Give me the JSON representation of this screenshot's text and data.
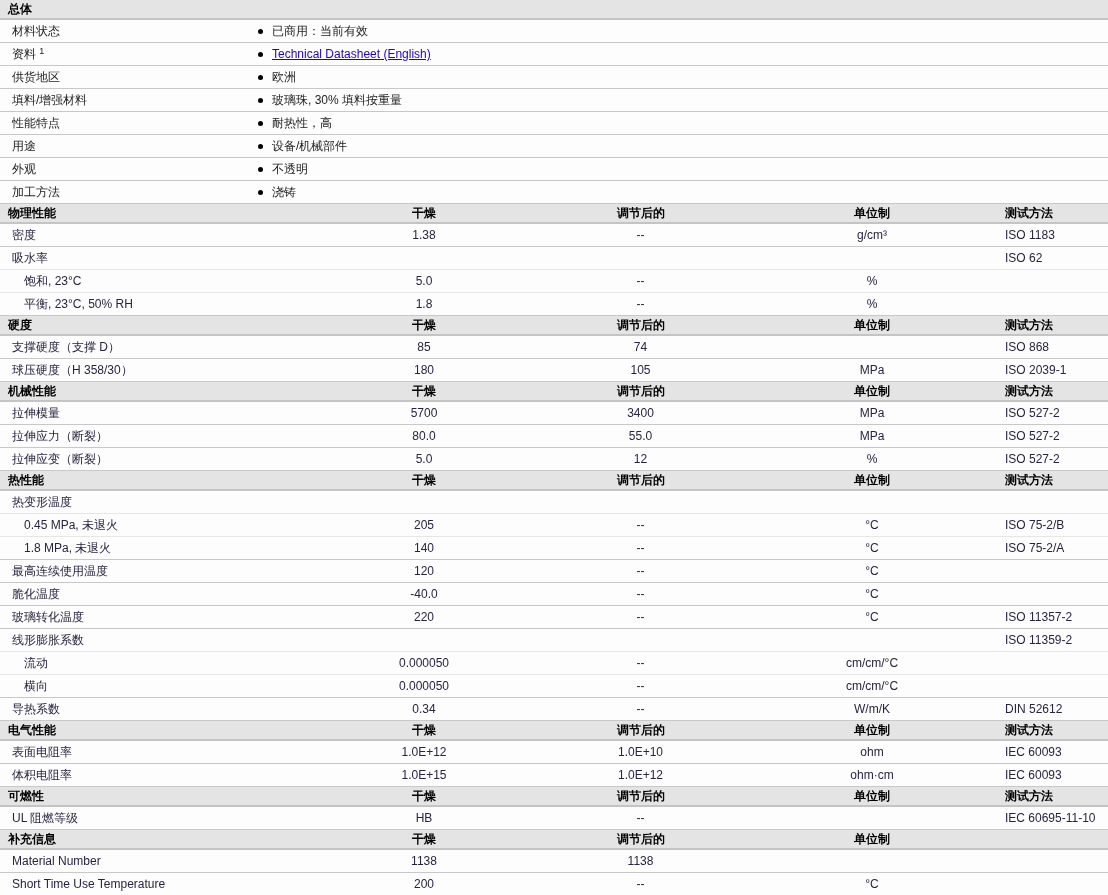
{
  "general": {
    "title": "总体",
    "rows": [
      {
        "label": "材料状态",
        "kind": "text",
        "value": "已商用：当前有效"
      },
      {
        "label": "资料 $^{1}$",
        "kind": "link",
        "value": "Technical Datasheet (English)"
      },
      {
        "label": "供货地区",
        "kind": "text",
        "value": "欧洲"
      },
      {
        "label": "填料/增强材料",
        "kind": "text",
        "value": "玻璃珠, 30% 填料按重量"
      },
      {
        "label": "性能特点",
        "kind": "text",
        "value": "耐热性，高"
      },
      {
        "label": "用途",
        "kind": "text",
        "value": "设备/机械部件"
      },
      {
        "label": "外观",
        "kind": "text",
        "value": "不透明"
      },
      {
        "label": "加工方法",
        "kind": "text",
        "value": "浇铸"
      }
    ]
  },
  "sections": [
    {
      "title": "物理性能",
      "columns": [
        "干燥",
        "调节后的",
        "单位制",
        "测试方法"
      ],
      "rows": [
        {
          "label": "密度",
          "dry": "1.38",
          "conditioned": "--",
          "unit": "g/cm³",
          "method": "ISO 1183"
        },
        {
          "label": "吸水率",
          "method": "ISO 62",
          "children": [
            {
              "label": "饱和, 23°C",
              "dry": "5.0",
              "conditioned": "--",
              "unit": "%"
            },
            {
              "label": "平衡, 23°C, 50% RH",
              "dry": "1.8",
              "conditioned": "--",
              "unit": "%"
            }
          ]
        }
      ]
    },
    {
      "title": "硬度",
      "columns": [
        "干燥",
        "调节后的",
        "单位制",
        "测试方法"
      ],
      "rows": [
        {
          "label": "支撑硬度（支撑  D）",
          "dry": "85",
          "conditioned": "74",
          "method": "ISO 868"
        },
        {
          "label": "球压硬度（H 358/30）",
          "dry": "180",
          "conditioned": "105",
          "unit": "MPa",
          "method": "ISO 2039-1"
        }
      ]
    },
    {
      "title": "机械性能",
      "columns": [
        "干燥",
        "调节后的",
        "单位制",
        "测试方法"
      ],
      "rows": [
        {
          "label": "拉伸模量",
          "dry": "5700",
          "conditioned": "3400",
          "unit": "MPa",
          "method": "ISO 527-2"
        },
        {
          "label": "拉伸应力（断裂）",
          "dry": "80.0",
          "conditioned": "55.0",
          "unit": "MPa",
          "method": "ISO 527-2"
        },
        {
          "label": "拉伸应变（断裂）",
          "dry": "5.0",
          "conditioned": "12",
          "unit": "%",
          "method": "ISO 527-2"
        }
      ]
    },
    {
      "title": "热性能",
      "columns": [
        "干燥",
        "调节后的",
        "单位制",
        "测试方法"
      ],
      "rows": [
        {
          "label": "热变形温度",
          "children": [
            {
              "label": "0.45 MPa, 未退火",
              "dry": "205",
              "conditioned": "--",
              "unit": "°C",
              "method": "ISO 75-2/B"
            },
            {
              "label": "1.8 MPa, 未退火",
              "dry": "140",
              "conditioned": "--",
              "unit": "°C",
              "method": "ISO 75-2/A"
            }
          ]
        },
        {
          "label": "最高连续使用温度",
          "dry": "120",
          "conditioned": "--",
          "unit": "°C"
        },
        {
          "label": "脆化温度",
          "dry": "-40.0",
          "conditioned": "--",
          "unit": "°C"
        },
        {
          "label": "玻璃转化温度",
          "dry": "220",
          "conditioned": "--",
          "unit": "°C",
          "method": "ISO 11357-2"
        },
        {
          "label": "线形膨胀系数",
          "method": "ISO 11359-2",
          "children": [
            {
              "label": "流动",
              "dry": "0.000050",
              "conditioned": "--",
              "unit": "cm/cm/°C"
            },
            {
              "label": "横向",
              "dry": "0.000050",
              "conditioned": "--",
              "unit": "cm/cm/°C"
            }
          ]
        },
        {
          "label": "导热系数",
          "dry": "0.34",
          "conditioned": "--",
          "unit": "W/m/K",
          "method": "DIN 52612"
        }
      ]
    },
    {
      "title": "电气性能",
      "columns": [
        "干燥",
        "调节后的",
        "单位制",
        "测试方法"
      ],
      "rows": [
        {
          "label": "表面电阻率",
          "dry": "1.0E+12",
          "conditioned": "1.0E+10",
          "unit": "ohm",
          "method": "IEC 60093"
        },
        {
          "label": "体积电阻率",
          "dry": "1.0E+15",
          "conditioned": "1.0E+12",
          "unit": "ohm·cm",
          "method": "IEC 60093"
        }
      ]
    },
    {
      "title": "可燃性",
      "columns": [
        "干燥",
        "调节后的",
        "单位制",
        "测试方法"
      ],
      "rows": [
        {
          "label": "UL 阻燃等级",
          "dry": "HB",
          "conditioned": "--",
          "method": "IEC 60695-11-10"
        }
      ]
    },
    {
      "title": "补充信息",
      "columns": [
        "干燥",
        "调节后的",
        "单位制"
      ],
      "rows": [
        {
          "label": "Material Number",
          "dry": "1138",
          "conditioned": "1138"
        },
        {
          "label": "Short Time Use Temperature",
          "dry": "200",
          "conditioned": "--",
          "unit": "°C"
        }
      ]
    }
  ]
}
